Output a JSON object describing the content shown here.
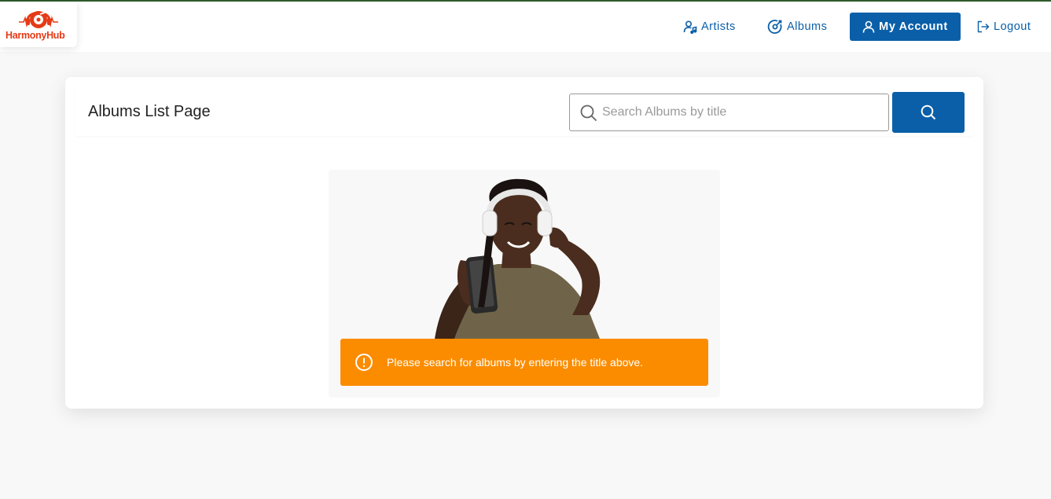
{
  "brand": {
    "name": "HarmonyHub",
    "color": "#e53a17"
  },
  "nav": {
    "artists_label": "Artists",
    "albums_label": "Albums",
    "account_label": "My Account",
    "logout_label": "Logout",
    "accent_color": "#0a5fa8"
  },
  "page": {
    "title": "Albums List Page"
  },
  "search": {
    "placeholder": "Search Albums by title",
    "value": ""
  },
  "alert": {
    "message": "Please search for albums by entering the title above.",
    "color": "#fb8c00",
    "icon": "exclamation-circle-icon"
  },
  "hero": {
    "image": "woman-headphones-smartphone"
  }
}
